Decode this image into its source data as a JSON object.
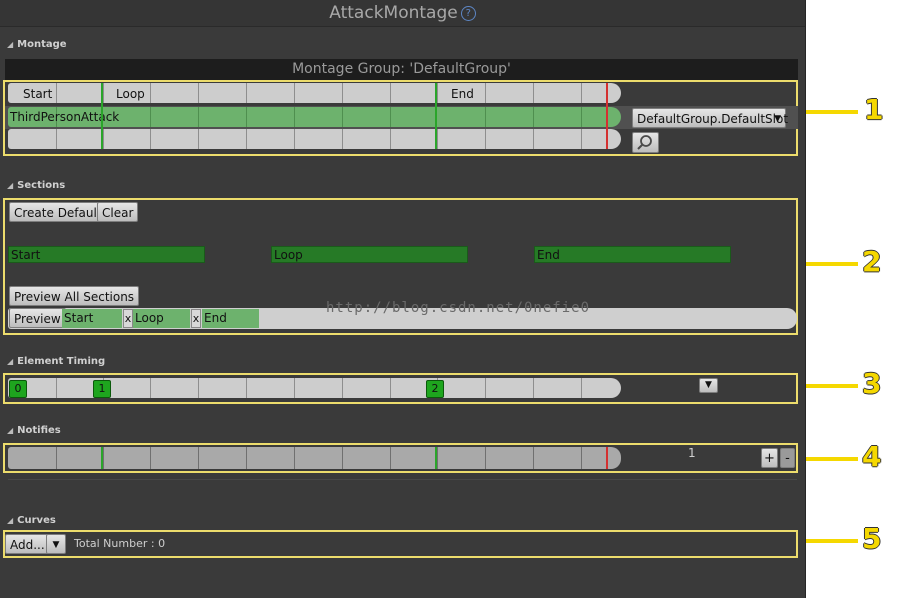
{
  "window": {
    "title": "AttackMontage"
  },
  "montage": {
    "label": "Montage",
    "group_title": "Montage Group: 'DefaultGroup'",
    "track_labels": [
      "Start",
      "Loop",
      "End"
    ],
    "slot_track_name": "ThirdPersonAttack",
    "slot_dropdown": "DefaultGroup.DefaultSlot"
  },
  "sections": {
    "label": "Sections",
    "create_default": "Create Default",
    "clear": "Clear",
    "bars": [
      "Start",
      "Loop",
      "End"
    ],
    "preview_all": "Preview All Sections",
    "preview": "Preview",
    "chain": [
      {
        "name": "Start",
        "x": "x"
      },
      {
        "name": "Loop",
        "x": "x"
      },
      {
        "name": "End",
        "x": ""
      }
    ]
  },
  "element_timing": {
    "label": "Element Timing",
    "markers": [
      "0",
      "1",
      "2"
    ]
  },
  "notifies": {
    "label": "Notifies",
    "count": "1",
    "add": "+",
    "remove": "-"
  },
  "curves": {
    "label": "Curves",
    "add": "Add...",
    "total": "Total Number : 0"
  },
  "callouts": [
    "1",
    "2",
    "3",
    "4",
    "5"
  ],
  "watermark": "http://blog.csdn.net/0nefie0",
  "colors": {
    "highlight": "#ecdc6c",
    "callout": "#f5d800",
    "section_green": "#267a26",
    "track_green": "#6db26d",
    "marker_green": "#1ea51e"
  }
}
